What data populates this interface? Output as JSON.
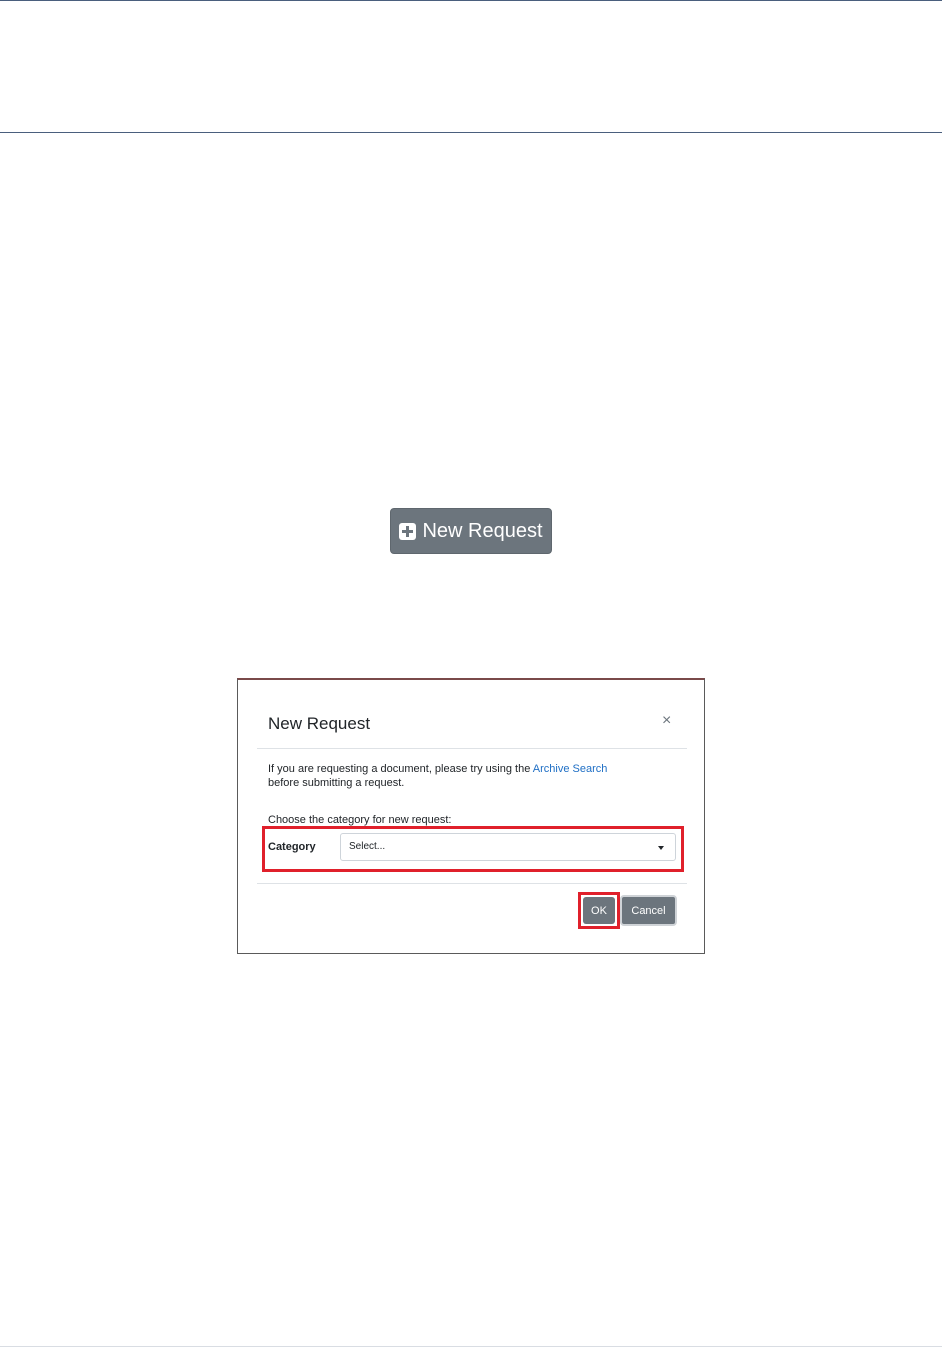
{
  "new_request_button": {
    "label": "New Request",
    "icon": "plus-square-icon"
  },
  "modal": {
    "title": "New Request",
    "close_glyph": "×",
    "intro_text": "If you are requesting a document, please try using the ",
    "archive_link": "Archive Search",
    "intro_text_after": "before submitting a request.",
    "choose_text": "Choose the category for new request:",
    "category_label": "Category",
    "category_select_value": "Select...",
    "ok_label": "OK",
    "cancel_label": "Cancel"
  },
  "colors": {
    "button_gray": "#6c757d",
    "highlight_red": "#e0202b",
    "link_blue": "#1f6fc5"
  }
}
